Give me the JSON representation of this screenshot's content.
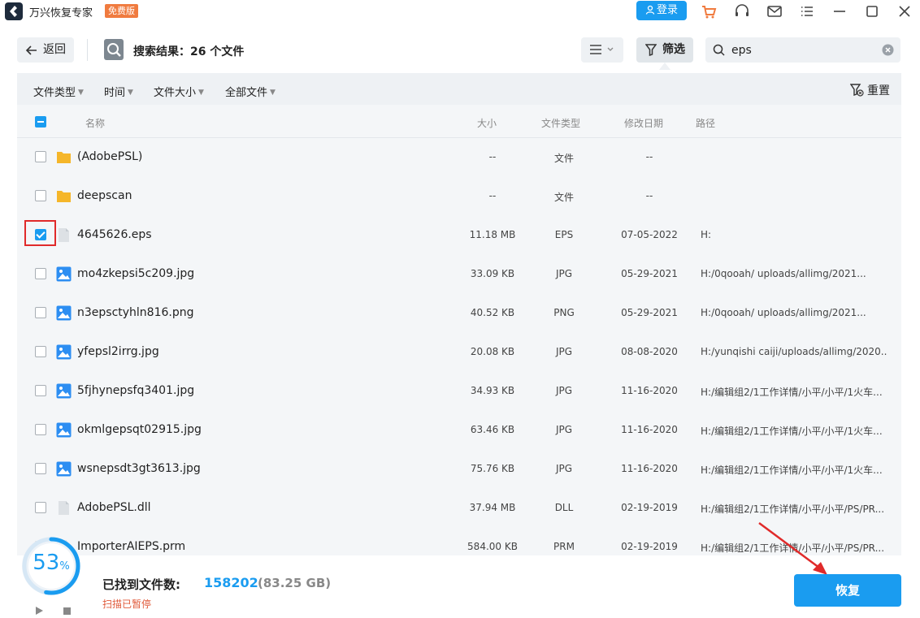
{
  "app": {
    "title": "万兴恢复专家",
    "badge": "免费版",
    "login_label": "登录"
  },
  "toolbar": {
    "back_label": "返回",
    "result_title": "搜索结果：26 个文件",
    "filter_label": "筛选",
    "search_value": "eps"
  },
  "filters": {
    "items": [
      "文件类型",
      "时间",
      "文件大小",
      "全部文件"
    ],
    "reset_label": "重置"
  },
  "table": {
    "columns": {
      "name": "名称",
      "size": "大小",
      "type": "文件类型",
      "date": "修改日期",
      "path": "路径"
    },
    "rows": [
      {
        "name": "(AdobePSL)",
        "size": "--",
        "type": "文件",
        "date": "--",
        "path": "",
        "icon": "folder-icon",
        "checked": false
      },
      {
        "name": "deepscan",
        "size": "--",
        "type": "文件",
        "date": "--",
        "path": "",
        "icon": "folder-icon",
        "checked": false
      },
      {
        "name": "4645626.eps",
        "size": "11.18 MB",
        "type": "EPS",
        "date": "07-05-2022",
        "path": "H:",
        "icon": "file-icon",
        "checked": true
      },
      {
        "name": "mo4zkepsi5c209.jpg",
        "size": "33.09 KB",
        "type": "JPG",
        "date": "05-29-2021",
        "path": "H:/0qooah/      uploads/allimg/2021...",
        "icon": "image-icon",
        "checked": false
      },
      {
        "name": "n3epsctyhln816.png",
        "size": "40.52 KB",
        "type": "PNG",
        "date": "05-29-2021",
        "path": "H:/0qooah/      uploads/allimg/2021...",
        "icon": "image-icon",
        "checked": false
      },
      {
        "name": "yfepsl2irrg.jpg",
        "size": "20.08 KB",
        "type": "JPG",
        "date": "08-08-2020",
        "path": "H:/yunqishi caiji/uploads/allimg/2020...",
        "icon": "image-icon",
        "checked": false
      },
      {
        "name": "5fjhynepsfq3401.jpg",
        "size": "34.93 KB",
        "type": "JPG",
        "date": "11-16-2020",
        "path": "H:/编辑组2/1工作详情/小平/小平/1火车...",
        "icon": "image-icon",
        "checked": false
      },
      {
        "name": "okmlgepsqt02915.jpg",
        "size": "63.46 KB",
        "type": "JPG",
        "date": "11-16-2020",
        "path": "H:/编辑组2/1工作详情/小平/小平/1火车...",
        "icon": "image-icon",
        "checked": false
      },
      {
        "name": "wsnepsdt3gt3613.jpg",
        "size": "75.76 KB",
        "type": "JPG",
        "date": "11-16-2020",
        "path": "H:/编辑组2/1工作详情/小平/小平/1火车...",
        "icon": "image-icon",
        "checked": false
      },
      {
        "name": "AdobePSL.dll",
        "size": "37.94 MB",
        "type": "DLL",
        "date": "02-19-2019",
        "path": "H:/编辑组2/1工作详情/小平/小平/PS/PR...",
        "icon": "file-icon",
        "checked": false
      },
      {
        "name": "ImporterAIEPS.prm",
        "size": "584.00 KB",
        "type": "PRM",
        "date": "02-19-2019",
        "path": "H:/编辑组2/1工作详情/小平/小平/PS/PR...",
        "icon": "file-icon",
        "checked": false
      }
    ]
  },
  "footer": {
    "progress_value": "53",
    "progress_unit": "%",
    "found_label": "已找到文件数:",
    "found_count": "158202",
    "found_size": "(83.25 GB)",
    "scan_status": "扫描已暂停",
    "recover_label": "恢复"
  },
  "colors": {
    "accent": "#1a9cf0",
    "badge": "#f07b3f",
    "highlight": "#e02a2a"
  }
}
